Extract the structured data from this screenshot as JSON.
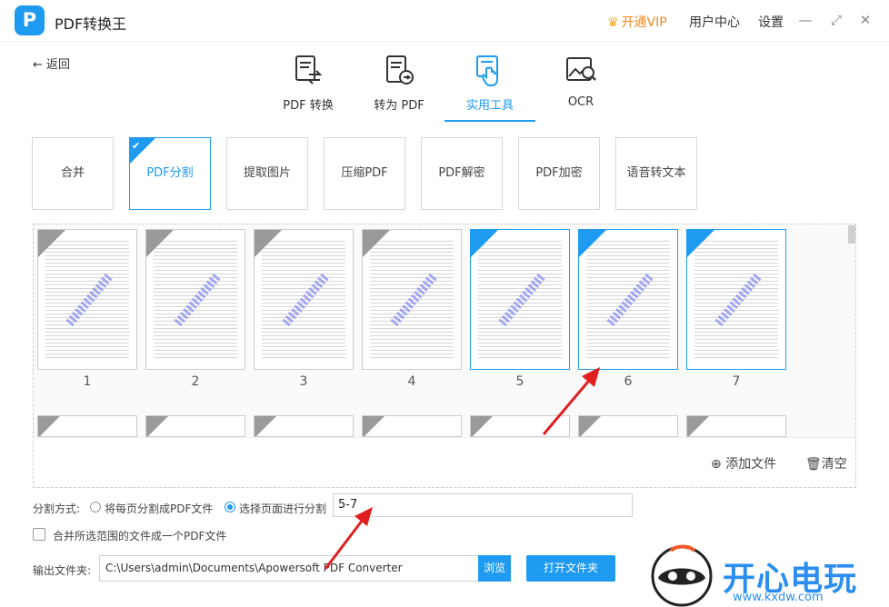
{
  "app": {
    "title": "PDF转换王",
    "logo_letter": "P",
    "vip": "开通VIP",
    "user_center": "用户中心",
    "settings": "设置"
  },
  "window": {
    "minimize": "—",
    "maximize": "⤢",
    "close": "✕"
  },
  "back": {
    "label": "返回"
  },
  "nav": [
    {
      "label": "PDF 转换",
      "icon": "pdf-convert-icon"
    },
    {
      "label": "转为 PDF",
      "icon": "to-pdf-icon"
    },
    {
      "label": "实用工具",
      "icon": "tools-icon"
    },
    {
      "label": "OCR",
      "icon": "ocr-icon"
    }
  ],
  "tools": [
    "合并",
    "PDF分割",
    "提取图片",
    "压缩PDF",
    "PDF解密",
    "PDF加密",
    "语音转文本"
  ],
  "pages": [
    "1",
    "2",
    "3",
    "4",
    "5",
    "6",
    "7"
  ],
  "selected_pages": [
    5,
    6,
    7
  ],
  "actions": {
    "add_file": "添加文件",
    "clear": "清空"
  },
  "split": {
    "label": "分割方式:",
    "option_each": "将每页分割成PDF文件",
    "option_select": "选择页面进行分割",
    "range_value": "5-7"
  },
  "merge_option": "合并所选范围的文件成一个PDF文件",
  "output": {
    "label": "输出文件夹:",
    "path": "C:\\Users\\admin\\Documents\\Apowersoft PDF Converter",
    "browse": "浏览",
    "open_folder": "打开文件夹"
  },
  "watermark": {
    "text": "开心电玩",
    "url": "www.kxdw.com"
  },
  "colors": {
    "accent": "#1e9bf0",
    "vip": "#f08a24",
    "annotation": "#e02020"
  }
}
